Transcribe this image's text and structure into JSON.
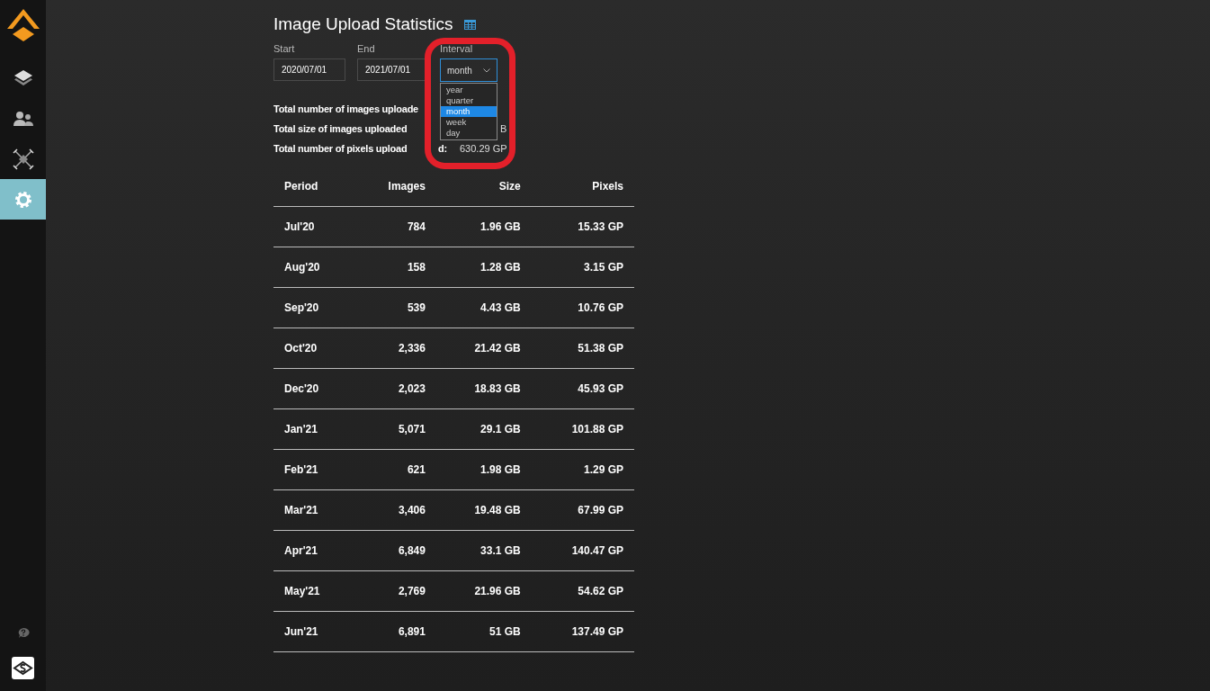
{
  "sidebar": {
    "items": [
      {
        "kind": "layers",
        "selected": false
      },
      {
        "kind": "users",
        "selected": false
      },
      {
        "kind": "drone",
        "selected": false
      },
      {
        "kind": "settings",
        "selected": true
      }
    ]
  },
  "page": {
    "title": "Image Upload Statistics",
    "filters": [
      {
        "kind": "date",
        "label": "Start",
        "value": "2020/07/01"
      },
      {
        "kind": "date",
        "label": "End",
        "value": "2021/07/01"
      },
      {
        "kind": "select",
        "label": "Interval",
        "value": "month",
        "expanded": true,
        "options": [
          {
            "label": "year",
            "selected": false
          },
          {
            "label": "quarter",
            "selected": false
          },
          {
            "label": "month",
            "selected": true
          },
          {
            "label": "week",
            "selected": false
          },
          {
            "label": "day",
            "selected": false
          }
        ]
      }
    ],
    "summary": [
      {
        "label": "Total number of images uploade"
      },
      {
        "label": "Total size of images uploaded",
        "tail": "B"
      },
      {
        "label": "Total number of pixels upload",
        "label_tail": "d:",
        "value": "630.29 GP"
      }
    ],
    "table": {
      "columns": [
        "Period",
        "Images",
        "Size",
        "Pixels"
      ],
      "rows": [
        [
          "Jul'20",
          "784",
          "1.96 GB",
          "15.33 GP"
        ],
        [
          "Aug'20",
          "158",
          "1.28 GB",
          "3.15 GP"
        ],
        [
          "Sep'20",
          "539",
          "4.43 GB",
          "10.76 GP"
        ],
        [
          "Oct'20",
          "2,336",
          "21.42 GB",
          "51.38 GP"
        ],
        [
          "Dec'20",
          "2,023",
          "18.83 GB",
          "45.93 GP"
        ],
        [
          "Jan'21",
          "5,071",
          "29.1 GB",
          "101.88 GP"
        ],
        [
          "Feb'21",
          "621",
          "1.98 GB",
          "1.29 GP"
        ],
        [
          "Mar'21",
          "3,406",
          "19.48 GB",
          "67.99 GP"
        ],
        [
          "Apr'21",
          "6,849",
          "33.1 GB",
          "140.47 GP"
        ],
        [
          "May'21",
          "2,769",
          "21.96 GB",
          "54.62 GP"
        ],
        [
          "Jun'21",
          "6,891",
          "51 GB",
          "137.49 GP"
        ]
      ]
    }
  },
  "annotation": {
    "kind": "ring"
  }
}
